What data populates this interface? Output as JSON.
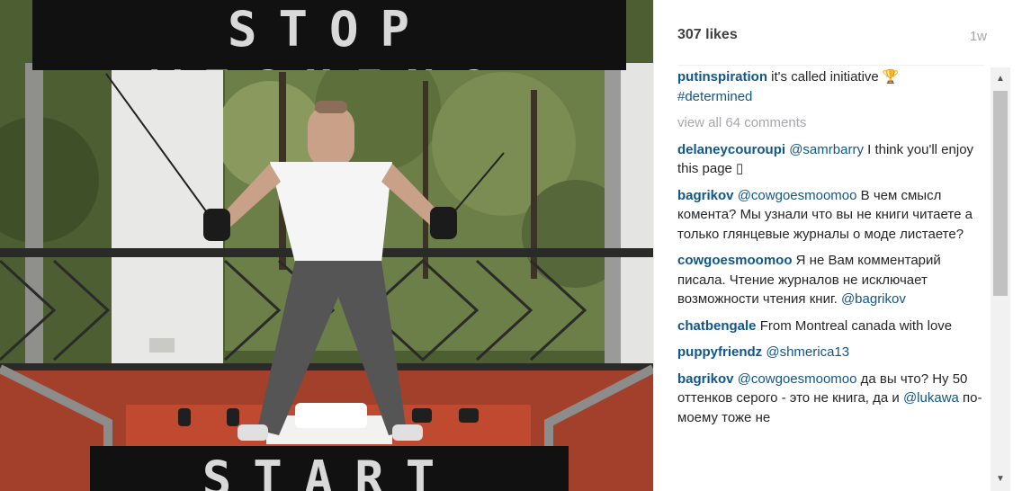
{
  "photo": {
    "top_banner": "STOP WISHING",
    "bottom_banner": "START DOING"
  },
  "post": {
    "likes": "307 likes",
    "age": "1w"
  },
  "caption": {
    "user": "putinspiration",
    "text": "it's called initiative 🏆",
    "hashtag": "#determined"
  },
  "view_all_comments": "view all 64 comments",
  "comments": [
    {
      "user": "delaneycouroupi",
      "mention": "@samrbarry",
      "text": " I think you'll enjoy this page ▯"
    },
    {
      "user": "bagrikov",
      "mention": "@cowgoesmoomoo",
      "text": " В чем смысл комента? Мы узнали что вы не книги читаете а только глянцевые журналы о моде листаете?"
    },
    {
      "user": "cowgoesmoomoo",
      "text": " Я не Вам комментарий писала. Чтение журналов не исключает возможности чтения книг. ",
      "mention_end": "@bagrikov"
    },
    {
      "user": "chatbengale",
      "text": " From Montreal canada with love"
    },
    {
      "user": "puppyfriendz",
      "mention": "@shmerica13",
      "text": ""
    },
    {
      "user": "bagrikov",
      "mention": "@cowgoesmoomoo",
      "text": " да вы что? Ну 50 оттенков серого - это не книга, да и ",
      "mention_mid": "@lukawa",
      "text2": " по-моему тоже не"
    }
  ],
  "icons": {
    "scroll_up": "scroll-up-arrow-icon",
    "scroll_down": "scroll-down-arrow-icon"
  },
  "colors": {
    "username": "#125688",
    "muted": "#a5a7aa",
    "text": "#262626"
  }
}
